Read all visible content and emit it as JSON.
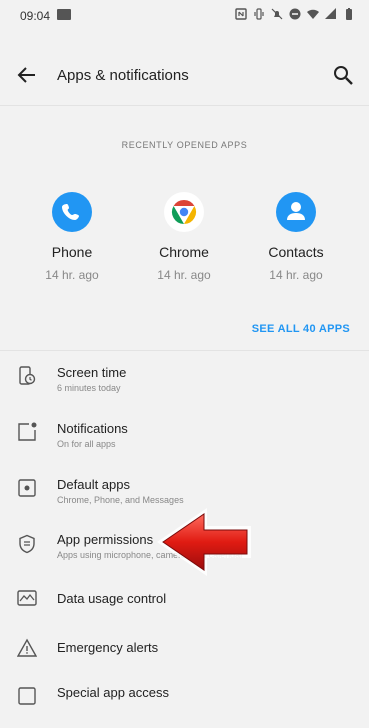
{
  "status": {
    "time": "09:04"
  },
  "appbar": {
    "title": "Apps & notifications"
  },
  "recent": {
    "heading": "RECENTLY OPENED APPS",
    "apps": [
      {
        "name": "Phone",
        "time": "14 hr. ago"
      },
      {
        "name": "Chrome",
        "time": "14 hr. ago"
      },
      {
        "name": "Contacts",
        "time": "14 hr. ago"
      }
    ],
    "see_all": "SEE ALL 40 APPS"
  },
  "items": [
    {
      "title": "Screen time",
      "subtitle": "6 minutes today"
    },
    {
      "title": "Notifications",
      "subtitle": "On for all apps"
    },
    {
      "title": "Default apps",
      "subtitle": "Chrome, Phone, and Messages"
    },
    {
      "title": "App permissions",
      "subtitle": "Apps using microphone, camera, and calendar"
    },
    {
      "title": "Data usage control"
    },
    {
      "title": "Emergency alerts"
    },
    {
      "title": "Special app access"
    }
  ],
  "colors": {
    "accent": "#2196f3",
    "annotation_arrow": "#d32f2f"
  }
}
